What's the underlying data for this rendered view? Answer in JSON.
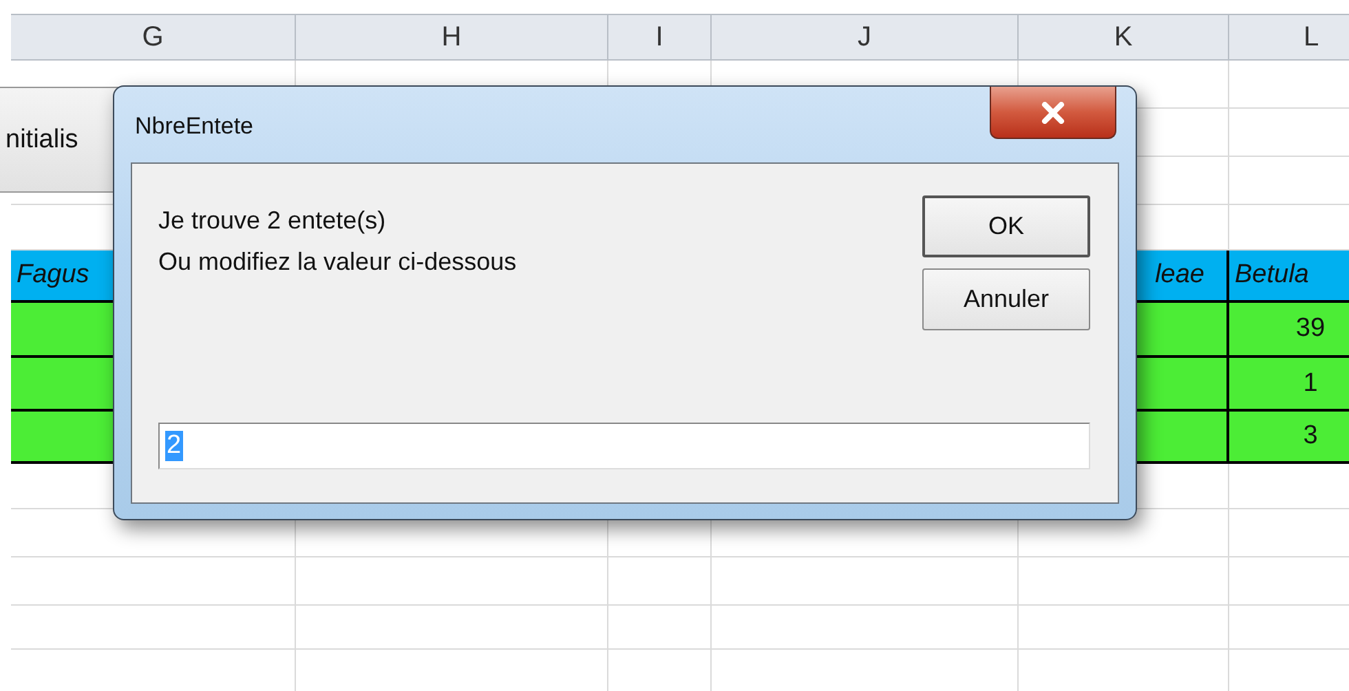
{
  "sheet": {
    "columns": [
      "G",
      "H",
      "I",
      "J",
      "K",
      "L"
    ],
    "rows": [
      {
        "kind": "blank",
        "cells": [
          {},
          {},
          {},
          {},
          {},
          {}
        ]
      },
      {
        "kind": "blank",
        "cells": [
          {},
          {},
          {},
          {},
          {},
          {}
        ]
      },
      {
        "kind": "blank",
        "cells": [
          {},
          {},
          {},
          {},
          {},
          {}
        ]
      },
      {
        "kind": "blank",
        "cells": [
          {},
          {},
          {},
          {},
          {},
          {}
        ]
      },
      {
        "kind": "header",
        "cells": [
          {
            "text": "Fagus"
          },
          {},
          {},
          {},
          {
            "text": "leae"
          },
          {
            "text": "Betula"
          }
        ]
      },
      {
        "kind": "data",
        "cells": [
          {},
          {},
          {},
          {},
          {},
          {
            "text": "39"
          }
        ]
      },
      {
        "kind": "data",
        "cells": [
          {},
          {},
          {},
          {},
          {},
          {
            "text": "1"
          }
        ]
      },
      {
        "kind": "data",
        "cells": [
          {},
          {},
          {},
          {},
          {},
          {
            "text": "3"
          }
        ]
      },
      {
        "kind": "blank",
        "cells": [
          {},
          {},
          {},
          {},
          {},
          {}
        ]
      },
      {
        "kind": "blank",
        "cells": [
          {},
          {},
          {},
          {},
          {},
          {}
        ]
      },
      {
        "kind": "blank",
        "cells": [
          {},
          {},
          {},
          {},
          {},
          {}
        ]
      },
      {
        "kind": "blank",
        "cells": [
          {},
          {},
          {},
          {},
          {},
          {}
        ]
      },
      {
        "kind": "blank",
        "cells": [
          {},
          {},
          {},
          {},
          {},
          {}
        ]
      }
    ],
    "form_button": {
      "label": "nitialis"
    }
  },
  "dialog": {
    "title": "NbreEntete",
    "message": [
      "Je trouve 2 entete(s)",
      "Ou modifiez la valeur ci-dessous"
    ],
    "buttons": [
      "OK",
      "Annuler"
    ],
    "input": {
      "value": "2",
      "selected": true
    }
  }
}
